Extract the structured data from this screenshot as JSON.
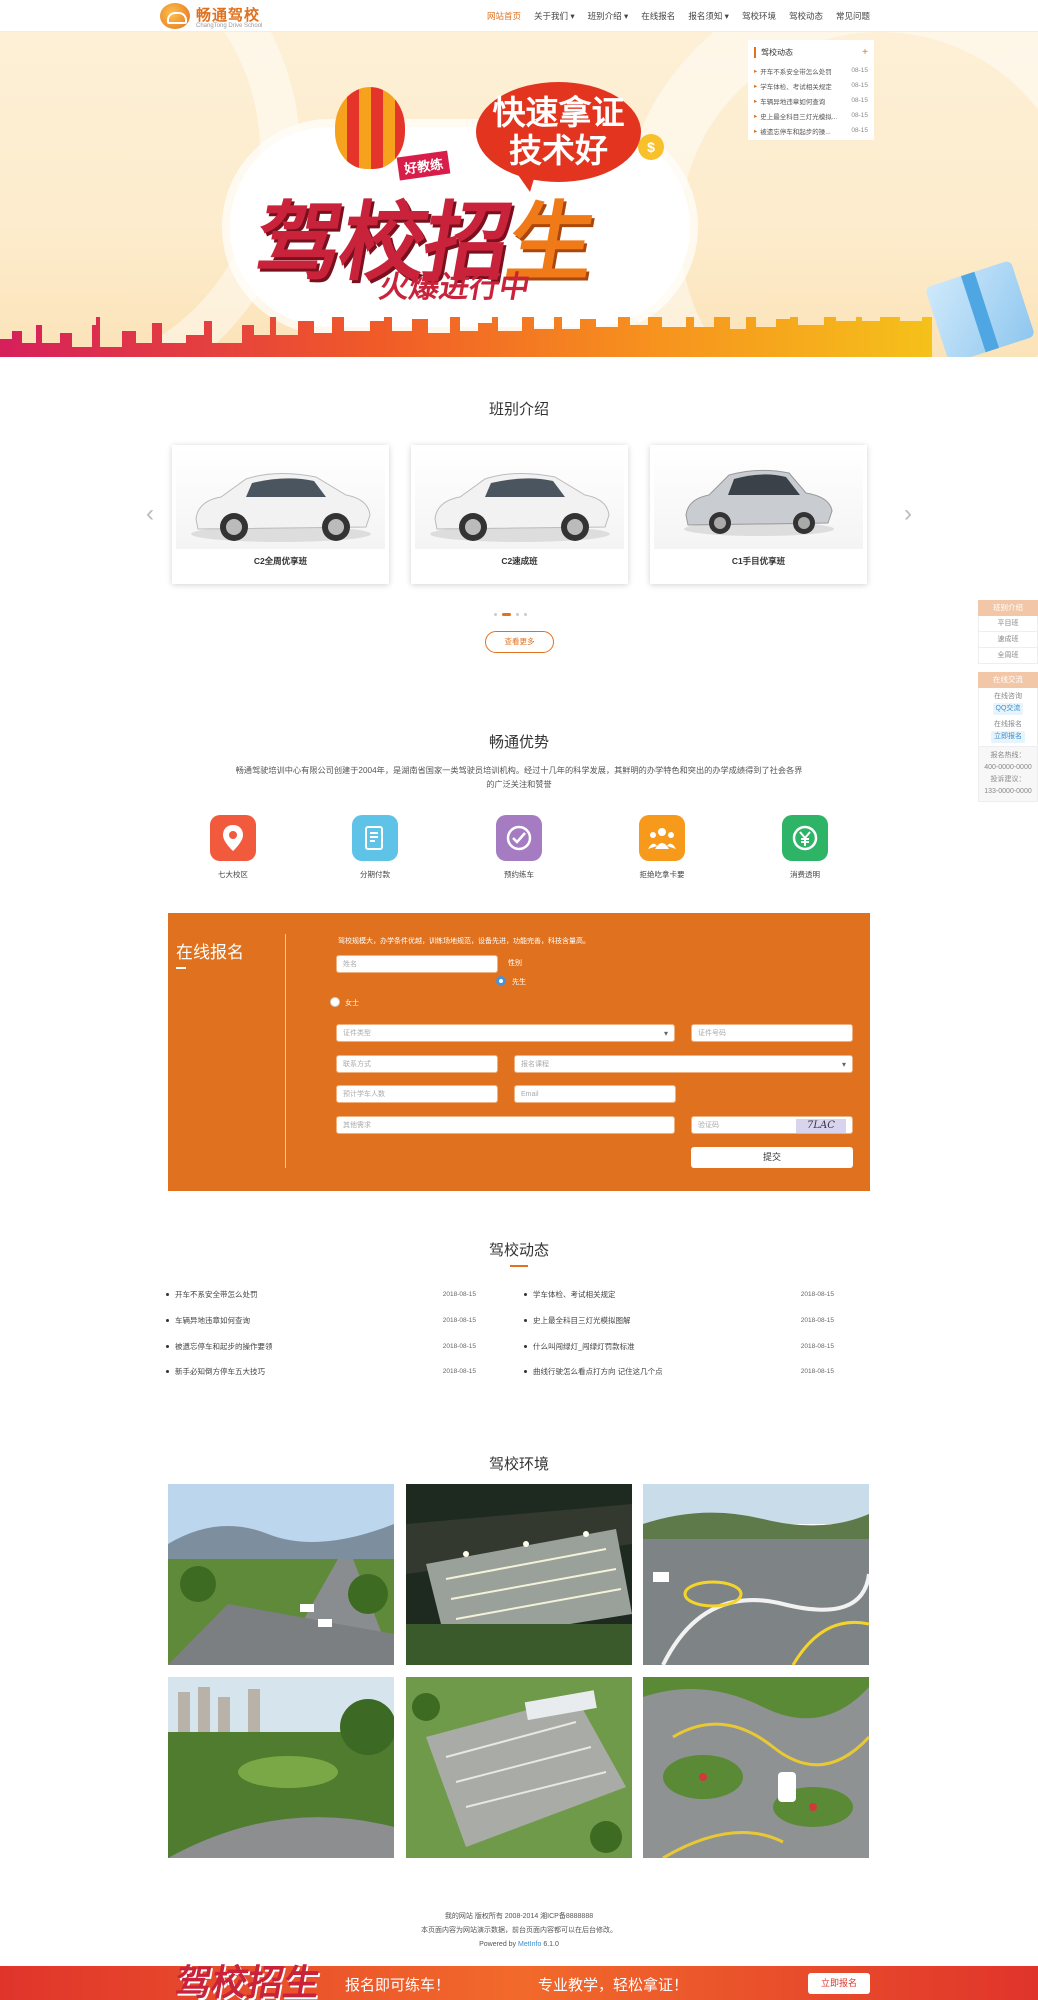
{
  "header": {
    "logo_cn": "畅通驾校",
    "logo_en": "ChangTong Drive School",
    "nav": [
      "网站首页",
      "关于我们 ▾",
      "班别介绍 ▾",
      "在线报名",
      "报名须知 ▾",
      "驾校环境",
      "驾校动态",
      "常见问题"
    ]
  },
  "banner": {
    "bubble_line1": "快速拿证",
    "bubble_line2": "技术好",
    "tag": "好教练",
    "big_a": "驾校招",
    "big_b": "生",
    "sub": "火爆进行中",
    "coin": "$"
  },
  "newsbox": {
    "title": "驾校动态",
    "plus": "+",
    "items": [
      {
        "t": "开车不系安全带怎么处罚",
        "d": "08-15"
      },
      {
        "t": "学车体检、考试相关规定",
        "d": "08-15"
      },
      {
        "t": "车辆异地违章如何查询",
        "d": "08-15"
      },
      {
        "t": "史上最全科目三灯光模拟...",
        "d": "08-15"
      },
      {
        "t": "被遗忘停车和起步的操...",
        "d": "08-15"
      }
    ]
  },
  "courses": {
    "title": "班别介绍",
    "items": [
      "C2全周优享班",
      "C2速成班",
      "C1手目优享班"
    ],
    "more": "查看更多"
  },
  "advantages": {
    "title": "畅通优势",
    "text": "畅通驾驶培训中心有限公司创建于2004年，是湖南省国家一类驾驶员培训机构。经过十几年的科学发展，其鲜明的办学特色和突出的办学成绩得到了社会各界的广泛关注和赞誉",
    "features": [
      {
        "label": "七大校区",
        "color": "#f15a3d",
        "icon": "location-icon"
      },
      {
        "label": "分期付款",
        "color": "#5fc3e8",
        "icon": "document-icon"
      },
      {
        "label": "预约练车",
        "color": "#a57bc1",
        "icon": "check-icon"
      },
      {
        "label": "拒绝吃拿卡要",
        "color": "#f79a1b",
        "icon": "people-icon"
      },
      {
        "label": "消费透明",
        "color": "#2eb467",
        "icon": "yuan-icon"
      }
    ]
  },
  "form": {
    "title": "在线报名",
    "intro": "驾校规模大，办学条件优越，训练场地规范，设备先进，功能完善，科技含量高。",
    "name_ph": "姓名",
    "gender_label": "性别",
    "male": "先生",
    "female": "女士",
    "idtype_ph": "证件类型",
    "idno_ph": "证件号码",
    "contact_ph": "联系方式",
    "course_ph": "报名课程",
    "count_ph": "预计学车人数",
    "email_ph": "Email",
    "other_ph": "其他需求",
    "captcha_ph": "验证码",
    "captcha_img": "7LAC",
    "submit": "提交"
  },
  "news": {
    "title": "驾校动态",
    "left": [
      {
        "t": "开车不系安全带怎么处罚",
        "d": "2018-08-15"
      },
      {
        "t": "车辆异地违章如何查询",
        "d": "2018-08-15"
      },
      {
        "t": "被遗忘停车和起步的操作要领",
        "d": "2018-08-15"
      },
      {
        "t": "新手必知倒方停车五大技巧",
        "d": "2018-08-15"
      }
    ],
    "right": [
      {
        "t": "学车体检、考试相关规定",
        "d": "2018-08-15"
      },
      {
        "t": "史上最全科目三灯光模拟图解",
        "d": "2018-08-15"
      },
      {
        "t": "什么叫闯绿灯_闯绿灯罚款标准",
        "d": "2018-08-15"
      },
      {
        "t": "曲线行驶怎么看点打方向 记住这几个点",
        "d": "2018-08-15"
      }
    ]
  },
  "environment": {
    "title": "驾校环境"
  },
  "sidebar": {
    "h1": "班别介绍",
    "items": [
      "平目班",
      "速成班",
      "全周班"
    ],
    "h2": "在线交流",
    "consult": "在线咨询",
    "qq": "QQ交流",
    "signup": "在线报名",
    "signup2": "立即报名",
    "tel_label": "报名热线：",
    "tel": "400-0000-0000",
    "sugg_label": "投诉建议：",
    "sugg": "133-0000-0000"
  },
  "footer": {
    "line1": "我的网站 版权所有 2008-2014 湘ICP备8888888",
    "line2": "本页面内容为网站演示数据，前台页面内容都可以在后台修改。",
    "powered": "Powered by",
    "met": "MetInfo",
    "ver": "6.1.0"
  },
  "bottombar": {
    "logo": "驾校招生",
    "slogan1": "报名即可练车！",
    "slogan2": "专业教学，轻松拿证！",
    "btn": "立即报名"
  },
  "colors": {
    "accent": "#e0721f",
    "red": "#e0342b"
  }
}
